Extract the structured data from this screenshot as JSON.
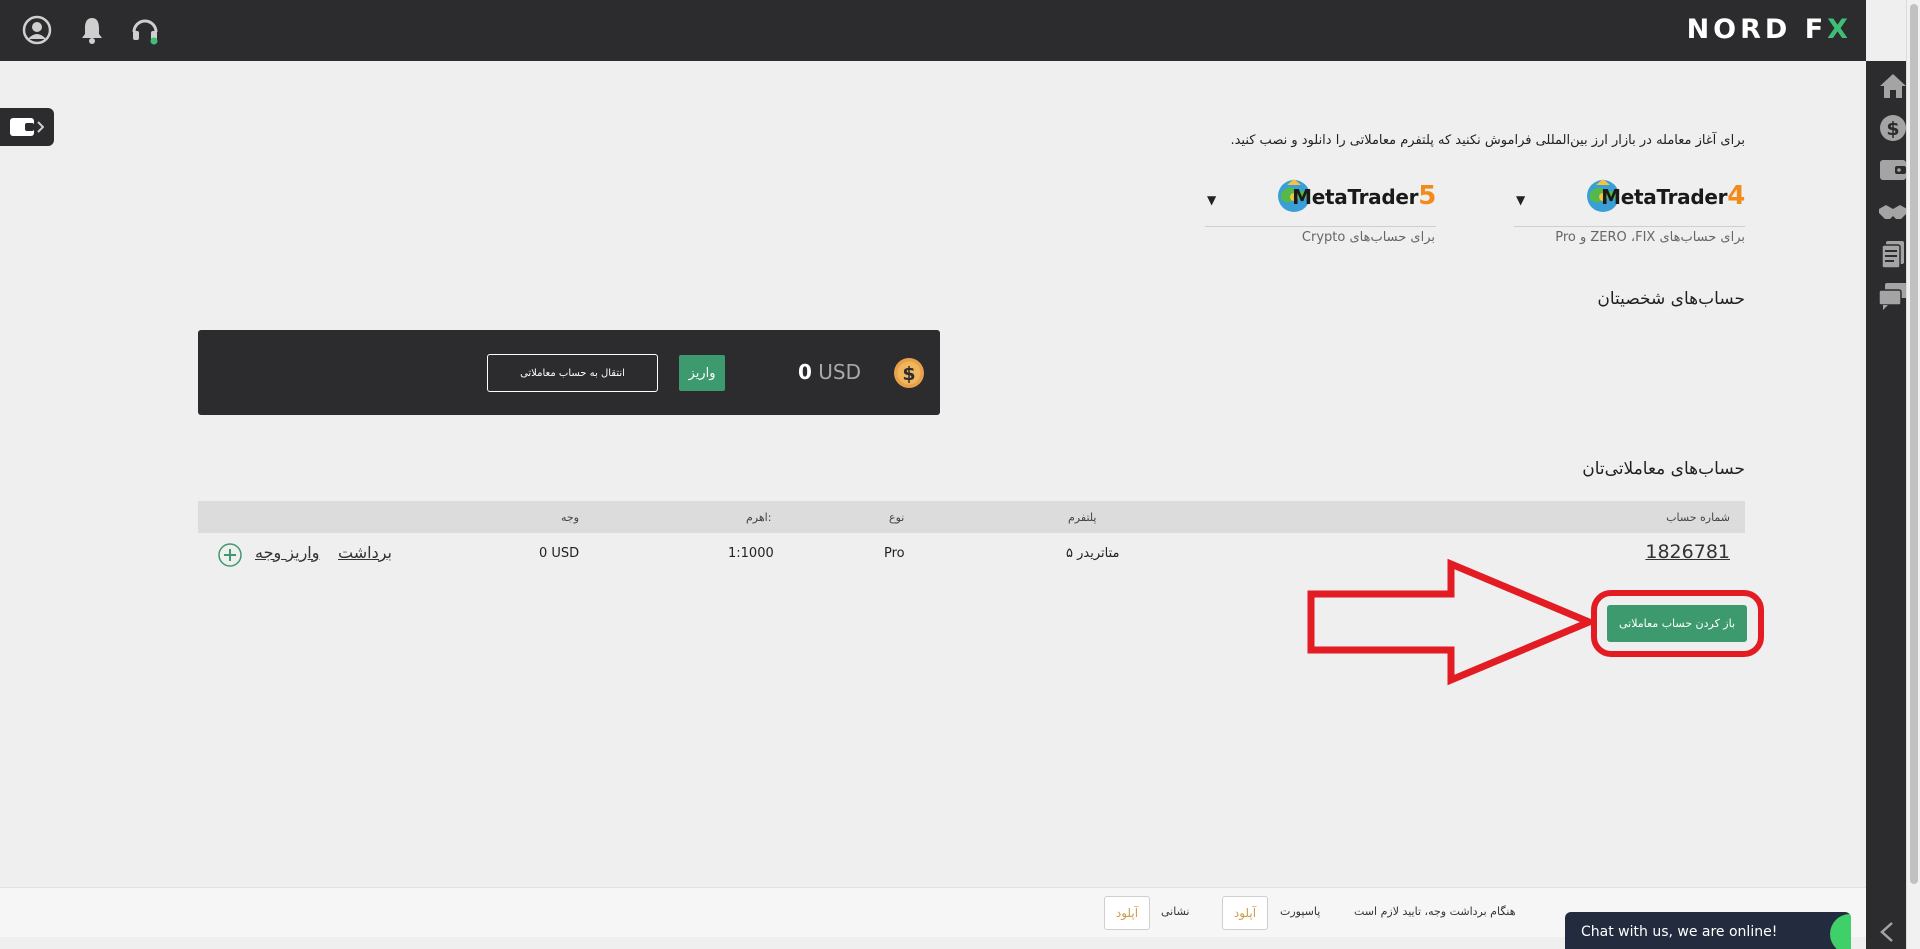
{
  "header": {
    "logo_main": "NORD F",
    "logo_accent": "X",
    "icons": [
      "user-icon",
      "bell-icon",
      "headset-icon"
    ]
  },
  "right_sidebar": {
    "icons": [
      "home-icon",
      "dollar-icon",
      "wallet-icon",
      "handshake-icon",
      "documents-icon",
      "chat-bubbles-icon"
    ]
  },
  "main": {
    "notice": "برای آغاز معامله در بازار ارز بین‌المللی فراموش نکنید که پلتفرم معاملاتی را دانلود و نصب کنید.",
    "platforms": [
      {
        "name": "MetaTrader",
        "version": "4",
        "subtitle": "برای حساب‌های ZERO ،FIX و Pro"
      },
      {
        "name": "MetaTrader",
        "version": "5",
        "subtitle": "برای حساب‌های Crypto"
      }
    ],
    "personal_title": "حساب‌های شخصیتان",
    "wallet": {
      "amount": "0",
      "currency": "USD",
      "deposit_label": "واریز",
      "transfer_label": "انتقال به حساب معاملاتی"
    },
    "trading_title": "حساب‌های معاملاتی‌تان",
    "table": {
      "headers": {
        "account": "شماره حساب",
        "platform": "پلتفرم",
        "type": "نوع",
        "leverage": "اهرم:",
        "funds": "وجه"
      },
      "rows": [
        {
          "account": "1826781",
          "platform": "متاتریدر ۵",
          "type": "Pro",
          "leverage": "1:1000",
          "funds": "0 USD",
          "withdraw": "برداشت",
          "deposit": "واریز وجه"
        }
      ]
    },
    "open_account_label": "باز کردن حساب معاملاتی"
  },
  "footer": {
    "notice": "هنگام برداشت وجه، تایید لازم است",
    "passport_label": "پاسپورت",
    "address_label": "نشانی",
    "upload_label": "آپلود"
  },
  "chat": {
    "label": "Chat with us, we are online!"
  },
  "colors": {
    "accent_green": "#3d9a6f",
    "dark_bar": "#2c2c2e",
    "highlight_red": "#e31b23",
    "mt_orange": "#f28a1c"
  }
}
